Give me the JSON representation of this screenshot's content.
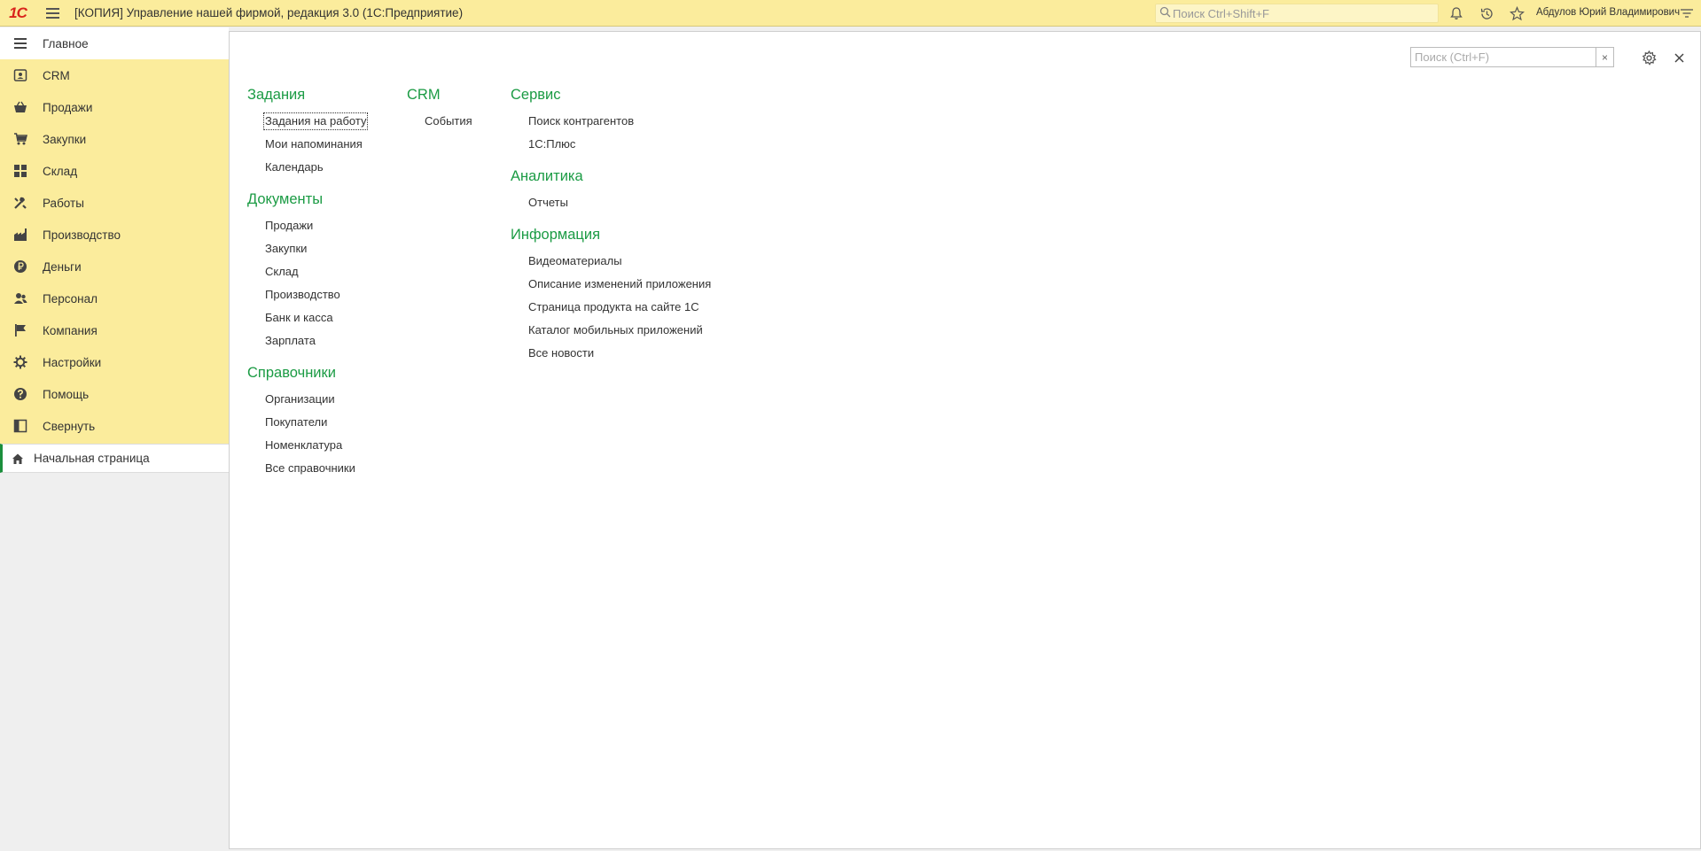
{
  "app": {
    "logo": "1С",
    "title": "[КОПИЯ] Управление нашей фирмой, редакция 3.0  (1С:Предприятие)",
    "search_placeholder": "Поиск Ctrl+Shift+F",
    "user": "Абдулов Юрий Владимирович"
  },
  "sidebar": {
    "items": [
      {
        "label": "Главное",
        "icon": "list-icon"
      },
      {
        "label": "CRM",
        "icon": "contact-card-icon"
      },
      {
        "label": "Продажи",
        "icon": "basket-icon"
      },
      {
        "label": "Закупки",
        "icon": "cart-icon"
      },
      {
        "label": "Склад",
        "icon": "grid-icon"
      },
      {
        "label": "Работы",
        "icon": "tools-icon"
      },
      {
        "label": "Производство",
        "icon": "factory-icon"
      },
      {
        "label": "Деньги",
        "icon": "ruble-icon"
      },
      {
        "label": "Персонал",
        "icon": "people-icon"
      },
      {
        "label": "Компания",
        "icon": "flag-icon"
      },
      {
        "label": "Настройки",
        "icon": "gear-icon"
      },
      {
        "label": "Помощь",
        "icon": "help-icon"
      },
      {
        "label": "Свернуть",
        "icon": "collapse-icon"
      }
    ],
    "home": "Начальная страница"
  },
  "main": {
    "search_placeholder": "Поиск (Ctrl+F)",
    "clear": "×",
    "columns": [
      {
        "sections": [
          {
            "title": "Задания",
            "items": [
              "Задания на работу",
              "Мои напоминания",
              "Календарь"
            ]
          },
          {
            "title": "Документы",
            "items": [
              "Продажи",
              "Закупки",
              "Склад",
              "Производство",
              "Банк и касса",
              "Зарплата"
            ]
          },
          {
            "title": "Справочники",
            "items": [
              "Организации",
              "Покупатели",
              "Номенклатура",
              "Все справочники"
            ]
          }
        ]
      },
      {
        "sections": [
          {
            "title": "CRM",
            "items": [
              "События"
            ]
          }
        ]
      },
      {
        "sections": [
          {
            "title": "Сервис",
            "items": [
              "Поиск контрагентов",
              "1С:Плюс"
            ]
          },
          {
            "title": "Аналитика",
            "items": [
              "Отчеты"
            ]
          },
          {
            "title": "Информация",
            "items": [
              "Видеоматериалы",
              "Описание изменений приложения",
              "Страница продукта на сайте 1С",
              "Каталог мобильных приложений",
              "Все новости"
            ]
          }
        ]
      }
    ]
  },
  "colors": {
    "accent_bg": "#fbec9c",
    "section_title": "#1b9b44",
    "home_marker": "#1b8f3c"
  }
}
